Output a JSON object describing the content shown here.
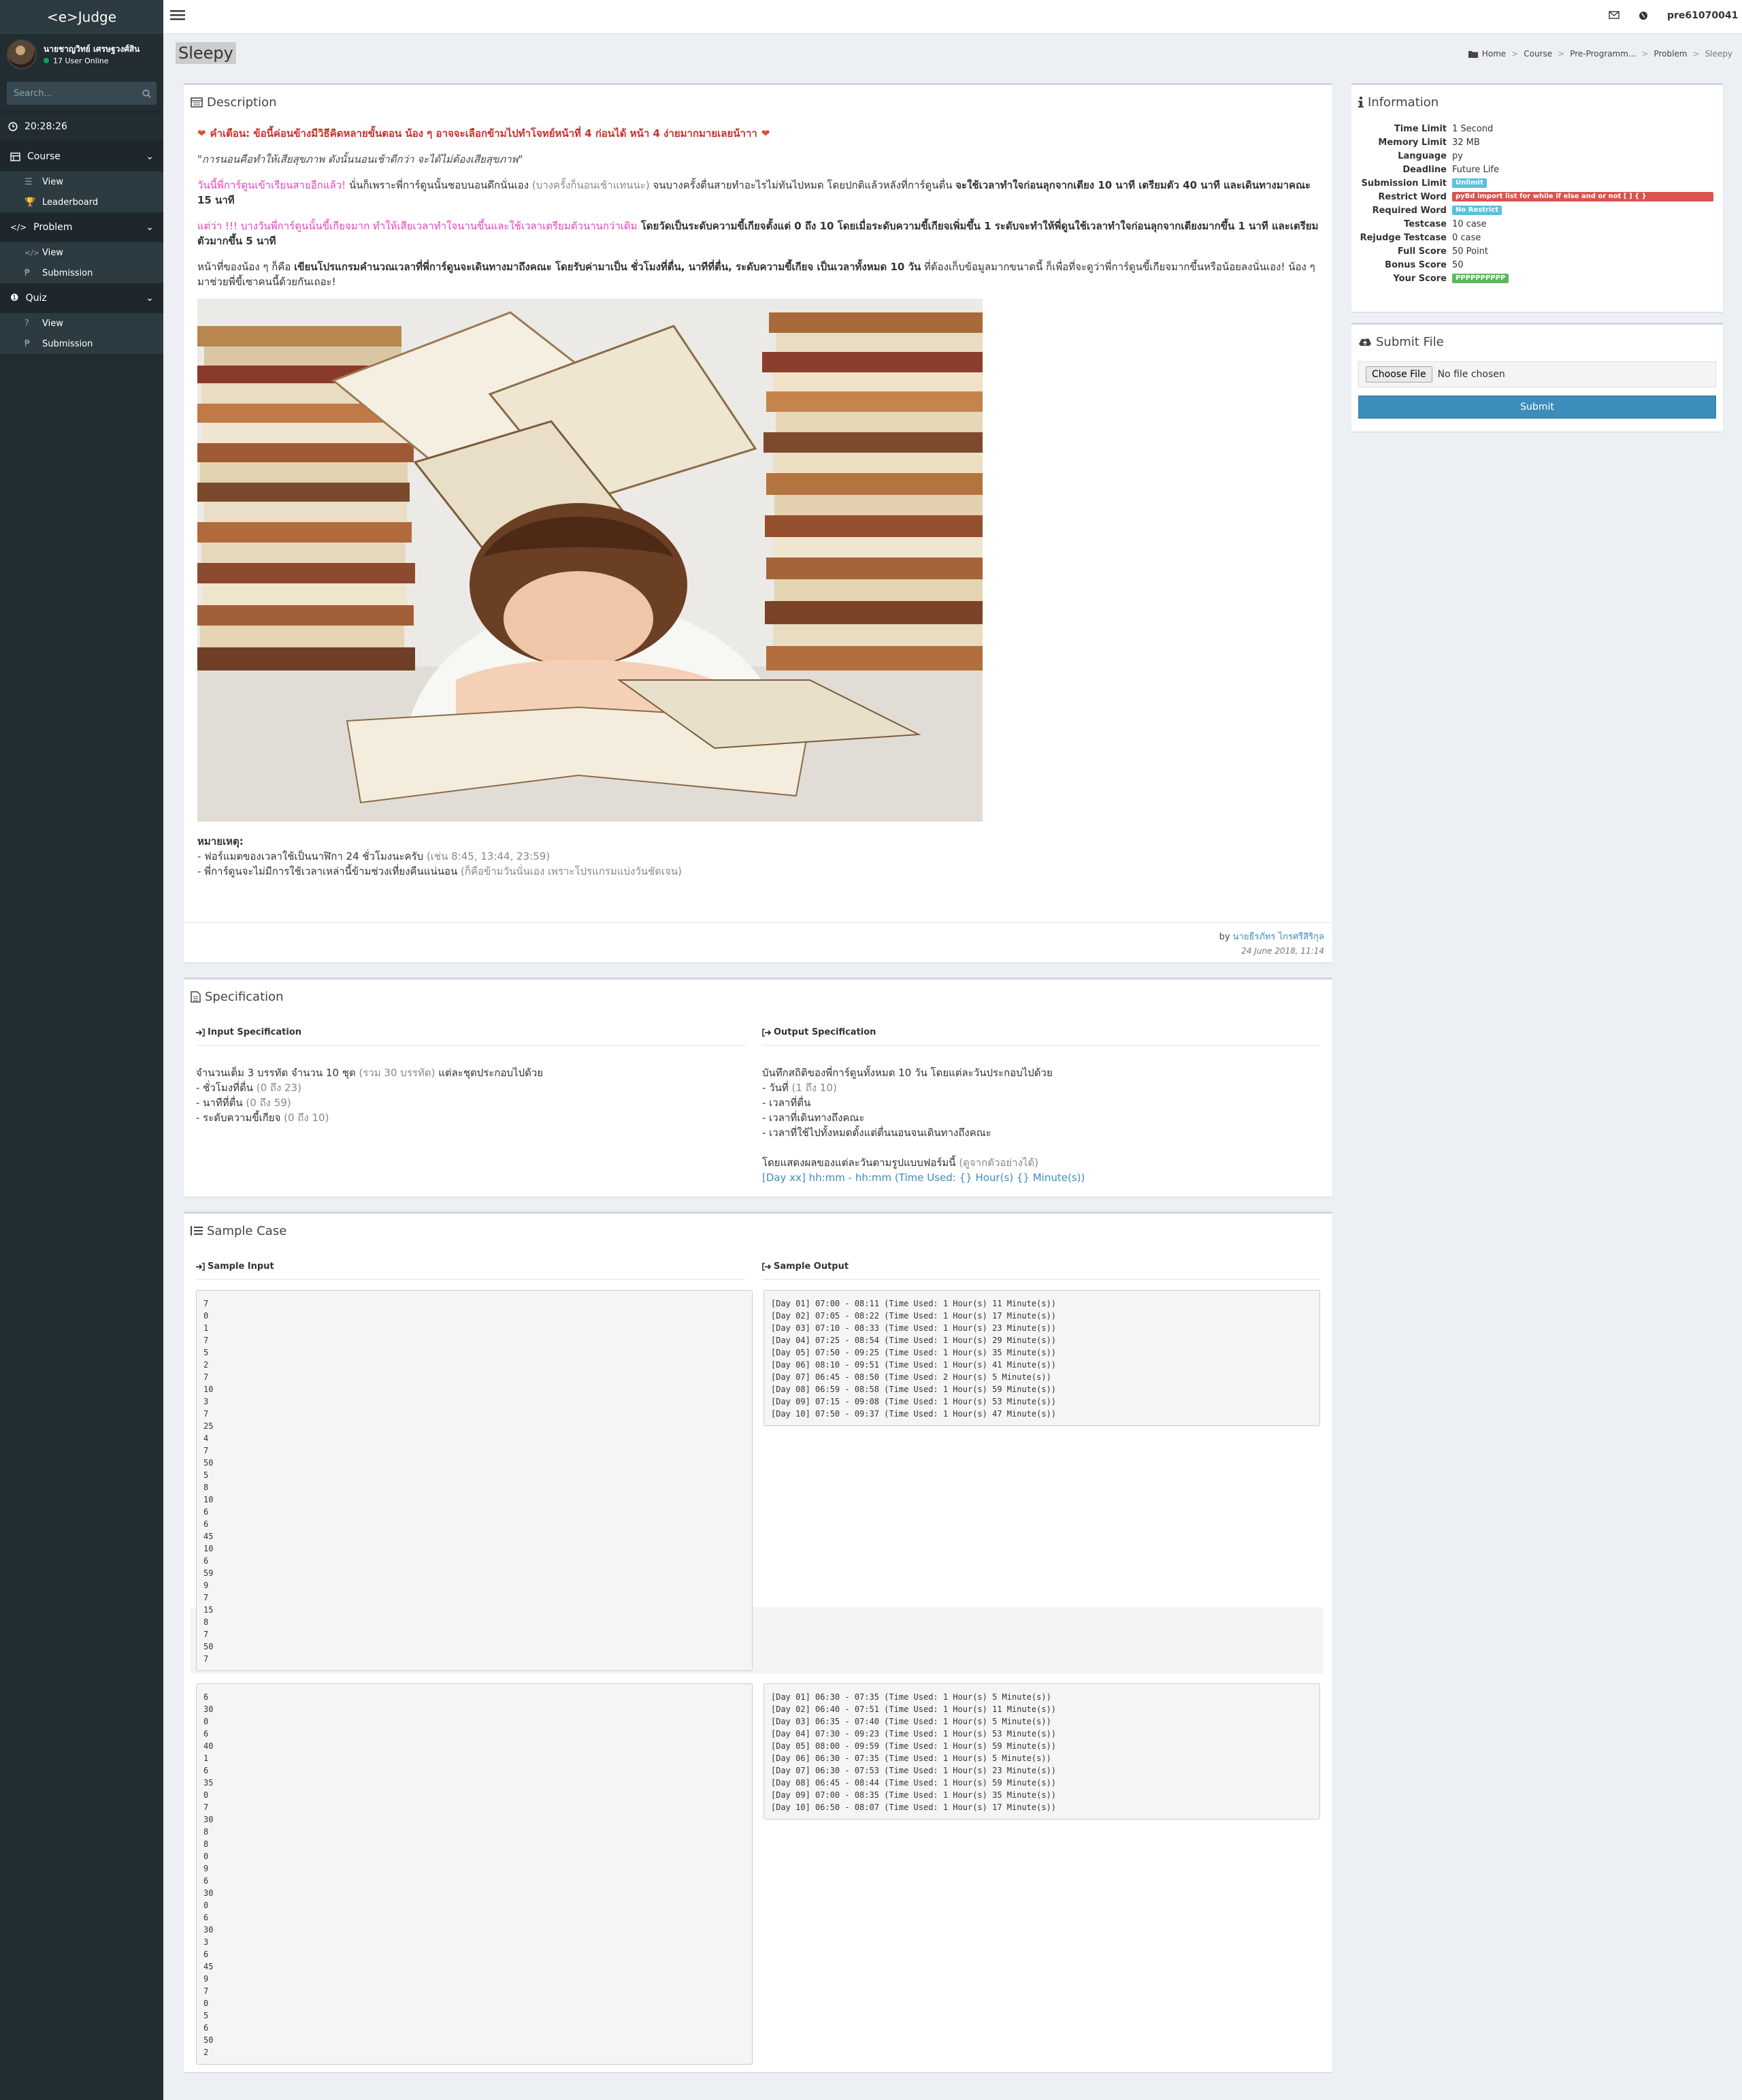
{
  "app": {
    "logo": "<e>Judge",
    "user_name": "นายชาญวิทย์ เศรษฐวงศ์สิน",
    "online": "17 User Online",
    "search_placeholder": "Search...",
    "clock": "20:28:26",
    "menu": [
      {
        "label": "Course",
        "items": [
          "View",
          "Leaderboard"
        ]
      },
      {
        "label": "Problem",
        "items": [
          "View",
          "Submission"
        ]
      },
      {
        "label": "Quiz",
        "items": [
          "View",
          "Submission"
        ]
      }
    ]
  },
  "topbar": {
    "username": "pre61070041"
  },
  "page": {
    "title": "Sleepy",
    "breadcrumb": [
      "Home",
      "Course",
      "Pre-Programm...",
      "Problem",
      "Sleepy"
    ]
  },
  "description": {
    "title": "Description",
    "warning": "คำเตือน: ข้อนี้ค่อนข้างมีวิธีคิดหลายขั้นตอน น้อง ๆ อาจจะเลือกข้ามไปทำโจทย์หน้าที่ 4 ก่อนได้ หน้า 4 ง่ายมากมายเลยน้าาา",
    "quote": "\"การนอนคือทำให้เสียสุขภาพ ดังนั้นนอนเช้าดีกว่า จะได้ไม่ต้องเสียสุขภาพ\"",
    "p1_pink": "วันนี้พี่การ์ดูนเข้าเรียนสายอีกแล้ว!",
    "p1_text": " นั่นก็เพราะพี่การ์ดูนนั้นชอบนอนดึกนั่นเอง ",
    "p1_muted": "(บางครั้งก็นอนเช้าแทนนะ)",
    "p1_text2": " จนบางครั้งตื่นสายทำอะไรไม่ทันไปหมด โดยปกติแล้วหลังที่การ์ดูนตื่น ",
    "p1_bold": "จะใช้เวลาทำใจก่อนลุกจากเตียง 10 นาที เตรียมตัว 40 นาที และเดินทางมาคณะ 15 นาที",
    "p2_pink": "แต่ว่า !!! บางวันพี่การ์ดูนนั้นขี้เกียจมาก ทำให้เสียเวลาทำใจนานขึ้นและใช้เวลาเตรียมตัวนานกว่าเดิม",
    "p2_bold": " โดยวัดเป็นระดับความขี้เกียจตั้งแต่ 0 ถึง 10 โดยเมื่อระดับความขี้เกียจเพิ่มขึ้น 1 ระดับจะทำให้พี่ดูนใช้เวลาทำใจก่อนลุกจากเตียงมากขึ้น 1 นาที และเตรียมตัวมากขึ้น 5 นาที",
    "p3_text": "หน้าที่ของน้อง ๆ ก็คือ ",
    "p3_bold": "เขียนโปรแกรมคำนวณเวลาที่พี่การ์ดูนจะเดินทางมาถึงคณะ โดยรับค่ามาเป็น ชั่วโมงที่ตื่น, นาทีที่ตื่น, ระดับความขี้เกียจ เป็นเวลาทั้งหมด 10 วัน",
    "p3_text2": " ที่ต้องเก็บข้อมูลมากขนาดนี้ ก็เพื่อที่จะดูว่าพี่การ์ดูนขี้เกียจมากขึ้นหรือน้อยลงนั่นเอง! น้อง ๆ มาช่วยพี่ขี้เซาคนนี้ด้วยกันเถอะ!",
    "note_title": "หมายเหตุ:",
    "note1": "- ฟอร์แมตของเวลาใช้เป็นนาฬิกา 24 ชั่วโมงนะครับ ",
    "note1_muted": "(เช่น 8:45, 13:44, 23:59)",
    "note2": "- พี่การ์ดูนจะไม่มีการใช้เวลาเหล่านี้ข้ามช่วงเที่ยงคืนแน่นอน ",
    "note2_muted": "(ก็คือข้ามวันนั่นเอง เพราะโปรแกรมแบ่งวันชัดเจน)",
    "by": "by ",
    "author": "นายธีรภัทร ไกรศรีสิริกุล",
    "date": "24 June 2018, 11:14"
  },
  "info": {
    "title": "Information",
    "rows": [
      {
        "label": "Time Limit",
        "value": "1 Second"
      },
      {
        "label": "Memory Limit",
        "value": "32 MB"
      },
      {
        "label": "Language",
        "value": "py"
      },
      {
        "label": "Deadline",
        "value": "Future Life"
      },
      {
        "label": "Submission Limit",
        "value": "Unlimit",
        "tag": "blue"
      },
      {
        "label": "Restrict Word",
        "value": "pyBd import list for while if else and or not [ ] { }",
        "tag": "red"
      },
      {
        "label": "Required Word",
        "value": "No Restrict",
        "tag": "blue"
      },
      {
        "label": "Testcase",
        "value": "10 case"
      },
      {
        "label": "Rejudge Testcase",
        "value": "0 case"
      },
      {
        "label": "Full Score",
        "value": "50 Point"
      },
      {
        "label": "Bonus Score",
        "value": "50"
      },
      {
        "label": "Your Score",
        "value": "PPPPPPPPPP",
        "tag": "green"
      }
    ],
    "colors": {
      "blue": "#5bc0de",
      "red": "#d9534f",
      "green": "#5cb85c"
    }
  },
  "submit": {
    "title": "Submit File",
    "choose": "Choose File",
    "no_file": "No file chosen",
    "button": "Submit"
  },
  "spec": {
    "title": "Specification",
    "input_head": "Input Specification",
    "output_head": "Output Specification",
    "input_lines": [
      {
        "text": "จำนวนเต็ม 3 บรรทัด จำนวน 10 ชุด ",
        "muted": "(รวม 30 บรรทัด)",
        "tail": " แต่ละชุดประกอบไปด้วย"
      },
      {
        "text": "- ชั่วโมงที่ตื่น ",
        "muted": "(0 ถึง 23)",
        "tail": ""
      },
      {
        "text": "- นาทีที่ตื่น ",
        "muted": "(0 ถึง 59)",
        "tail": ""
      },
      {
        "text": "- ระดับความขี้เกียจ ",
        "muted": "(0 ถึง 10)",
        "tail": ""
      }
    ],
    "output_lines": [
      {
        "text": "บันทึกสถิติของพี่การ์ดูนทั้งหมด 10 วัน โดยแต่ละวันประกอบไปด้วย",
        "muted": "",
        "tail": ""
      },
      {
        "text": "- วันที่ ",
        "muted": "(1 ถึง 10)",
        "tail": ""
      },
      {
        "text": "- เวลาที่ตื่น",
        "muted": "",
        "tail": ""
      },
      {
        "text": "- เวลาที่เดินทางถึงคณะ",
        "muted": "",
        "tail": ""
      },
      {
        "text": "- เวลาที่ใช้ไปทั้งหมดตั้งแต่ตื่นนอนจนเดินทางถึงคณะ",
        "muted": "",
        "tail": ""
      }
    ],
    "output_format_intro": "โดยแสดงผลของแต่ละวันตามรูปแบบฟอร์มนี้ ",
    "output_format_muted": "(ดูจากตัวอย่างได้)",
    "output_format": "[Day xx] hh:mm - hh:mm (Time Used: {} Hour(s) {} Minute(s))"
  },
  "sample": {
    "title": "Sample Case",
    "input_head": "Sample Input",
    "output_head": "Sample Output",
    "input1": "7\n0\n1\n7\n5\n2\n7\n10\n3\n7\n25\n4\n7\n50\n5\n8\n10\n6\n6\n45\n10\n6\n59\n9\n7\n15\n8\n7\n50\n7",
    "output1": "[Day 01] 07:00 - 08:11 (Time Used: 1 Hour(s) 11 Minute(s))\n[Day 02] 07:05 - 08:22 (Time Used: 1 Hour(s) 17 Minute(s))\n[Day 03] 07:10 - 08:33 (Time Used: 1 Hour(s) 23 Minute(s))\n[Day 04] 07:25 - 08:54 (Time Used: 1 Hour(s) 29 Minute(s))\n[Day 05] 07:50 - 09:25 (Time Used: 1 Hour(s) 35 Minute(s))\n[Day 06] 08:10 - 09:51 (Time Used: 1 Hour(s) 41 Minute(s))\n[Day 07] 06:45 - 08:50 (Time Used: 2 Hour(s) 5 Minute(s))\n[Day 08] 06:59 - 08:58 (Time Used: 1 Hour(s) 59 Minute(s))\n[Day 09] 07:15 - 09:08 (Time Used: 1 Hour(s) 53 Minute(s))\n[Day 10] 07:50 - 09:37 (Time Used: 1 Hour(s) 47 Minute(s))",
    "input2": "6\n30\n0\n6\n40\n1\n6\n35\n0\n7\n30\n8\n8\n0\n9\n6\n30\n0\n6\n30\n3\n6\n45\n9\n7\n0\n5\n6\n50\n2",
    "output2": "[Day 01] 06:30 - 07:35 (Time Used: 1 Hour(s) 5 Minute(s))\n[Day 02] 06:40 - 07:51 (Time Used: 1 Hour(s) 11 Minute(s))\n[Day 03] 06:35 - 07:40 (Time Used: 1 Hour(s) 5 Minute(s))\n[Day 04] 07:30 - 09:23 (Time Used: 1 Hour(s) 53 Minute(s))\n[Day 05] 08:00 - 09:59 (Time Used: 1 Hour(s) 59 Minute(s))\n[Day 06] 06:30 - 07:35 (Time Used: 1 Hour(s) 5 Minute(s))\n[Day 07] 06:30 - 07:53 (Time Used: 1 Hour(s) 23 Minute(s))\n[Day 08] 06:45 - 08:44 (Time Used: 1 Hour(s) 59 Minute(s))\n[Day 09] 07:00 - 08:35 (Time Used: 1 Hour(s) 35 Minute(s))\n[Day 10] 06:50 - 08:07 (Time Used: 1 Hour(s) 17 Minute(s))"
  }
}
